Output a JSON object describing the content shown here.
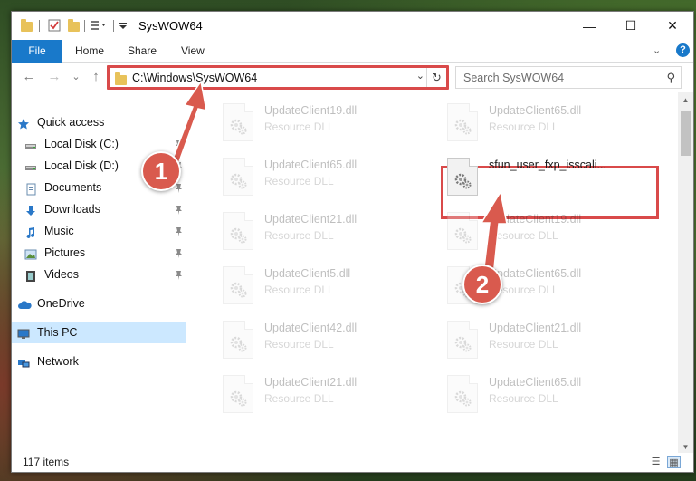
{
  "window": {
    "title": "SysWOW64",
    "minimize_glyph": "—",
    "maximize_glyph": "☐",
    "close_glyph": "✕"
  },
  "ribbon": {
    "tabs": [
      "File",
      "Home",
      "Share",
      "View"
    ],
    "expand_glyph": "⌄",
    "help_glyph": "?"
  },
  "nav": {
    "back_glyph": "←",
    "forward_glyph": "→",
    "recent_glyph": "⌄",
    "up_glyph": "↑",
    "address": "C:\\Windows\\SysWOW64",
    "address_drop_glyph": "⌄",
    "refresh_glyph": "↻",
    "search_placeholder": "Search SysWOW64",
    "search_glyph": "⚲"
  },
  "sidebar": {
    "items": [
      {
        "label": "Quick access",
        "icon": "star-icon",
        "pinned": false
      },
      {
        "label": "Local Disk (C:)",
        "icon": "drive-icon",
        "pinned": true
      },
      {
        "label": "Local Disk (D:)",
        "icon": "drive-icon",
        "pinned": true
      },
      {
        "label": "Documents",
        "icon": "documents-icon",
        "pinned": true
      },
      {
        "label": "Downloads",
        "icon": "download-icon",
        "pinned": true
      },
      {
        "label": "Music",
        "icon": "music-icon",
        "pinned": true
      },
      {
        "label": "Pictures",
        "icon": "pictures-icon",
        "pinned": true
      },
      {
        "label": "Videos",
        "icon": "video-icon",
        "pinned": true
      },
      {
        "label": "OneDrive",
        "icon": "cloud-icon",
        "pinned": false
      },
      {
        "label": "This PC",
        "icon": "computer-icon",
        "pinned": false,
        "selected": true
      },
      {
        "label": "Network",
        "icon": "network-icon",
        "pinned": false
      }
    ],
    "pin_glyph": "📌"
  },
  "files": {
    "left": [
      {
        "name": "UpdateClient19.dll",
        "type": "Resource DLL"
      },
      {
        "name": "UpdateClient65.dll",
        "type": "Resource DLL"
      },
      {
        "name": "UpdateClient21.dll",
        "type": "Resource DLL"
      },
      {
        "name": "UpdateClient5.dll",
        "type": "Resource DLL"
      },
      {
        "name": "UpdateClient42.dll",
        "type": "Resource DLL"
      },
      {
        "name": "UpdateClient21.dll",
        "type": "Resource DLL"
      }
    ],
    "right": [
      {
        "name": "UpdateClient65.dll",
        "type": "Resource DLL"
      },
      {
        "name": "sfun_user_fxp_isscali...",
        "type": ""
      },
      {
        "name": "UpdateClient19.dll",
        "type": "Resource DLL"
      },
      {
        "name": "UpdateClient65.dll",
        "type": "Resource DLL"
      },
      {
        "name": "UpdateClient21.dll",
        "type": "Resource DLL"
      },
      {
        "name": "UpdateClient65.dll",
        "type": "Resource DLL"
      }
    ]
  },
  "status": {
    "item_count": "117 items",
    "details_view_glyph": "☰",
    "icons_view_glyph": "▦"
  },
  "annotations": {
    "step1": "1",
    "step2": "2",
    "color": "#d94a4a"
  }
}
